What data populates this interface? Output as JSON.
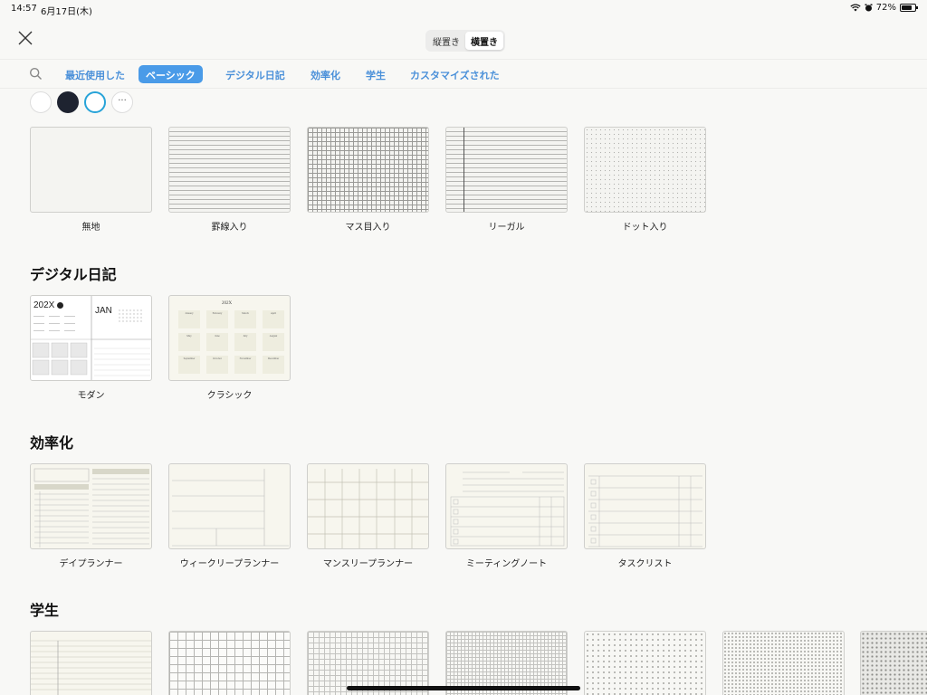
{
  "status": {
    "time": "14:57",
    "date": "6月17日(木)",
    "battery": "72%"
  },
  "header": {
    "orientation": {
      "portrait": "縦置き",
      "landscape": "横置き",
      "selected": "landscape"
    }
  },
  "tabs": [
    {
      "label": "最近使用した",
      "active": false
    },
    {
      "label": "ベーシック",
      "active": true
    },
    {
      "label": "デジタル日記",
      "active": false
    },
    {
      "label": "効率化",
      "active": false
    },
    {
      "label": "学生",
      "active": false
    },
    {
      "label": "カスタマイズされた",
      "active": false
    }
  ],
  "swatches": [
    "white",
    "dark",
    "selected-white",
    "more"
  ],
  "swatch_colors": {
    "white": "#ffffff",
    "dark": "#1e2330",
    "selected_ring": "#27a3d8",
    "accent": "#4a9be8"
  },
  "more_glyph": "···",
  "basic": {
    "items": [
      {
        "label": "無地"
      },
      {
        "label": "罫線入り"
      },
      {
        "label": "マス目入り"
      },
      {
        "label": "リーガル"
      },
      {
        "label": "ドット入り"
      }
    ]
  },
  "digital": {
    "title": "デジタル日記",
    "items": [
      {
        "label": "モダン",
        "thumb_year": "202X",
        "thumb_month": "JAN"
      },
      {
        "label": "クラシック",
        "thumb_year": "202X",
        "months": [
          "January",
          "February",
          "March",
          "April",
          "May",
          "June",
          "July",
          "August",
          "September",
          "October",
          "November",
          "December"
        ]
      }
    ]
  },
  "productivity": {
    "title": "効率化",
    "items": [
      {
        "label": "デイプランナー"
      },
      {
        "label": "ウィークリープランナー"
      },
      {
        "label": "マンスリープランナー"
      },
      {
        "label": "ミーティングノート"
      },
      {
        "label": "タスクリスト"
      }
    ]
  },
  "student": {
    "title": "学生"
  }
}
